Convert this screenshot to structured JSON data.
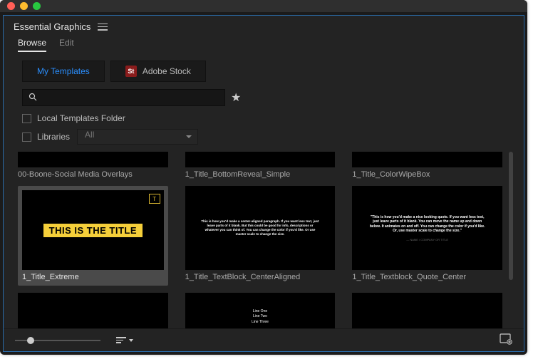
{
  "panel": {
    "title": "Essential Graphics"
  },
  "tabs": {
    "browse": "Browse",
    "edit": "Edit"
  },
  "filters": {
    "my_templates": "My Templates",
    "adobe_stock": "Adobe Stock",
    "st_badge": "St"
  },
  "search": {
    "placeholder": ""
  },
  "checks": {
    "local_templates": "Local Templates Folder",
    "libraries": "Libraries",
    "libraries_select": "All"
  },
  "items": [
    {
      "label": "00-Boone-Social Media Overlays"
    },
    {
      "label": "1_Title_BottomReveal_Simple"
    },
    {
      "label": "1_Title_ColorWipeBox"
    },
    {
      "label": "1_Title_Extreme",
      "preview_title": "THIS IS THE TITLE"
    },
    {
      "label": "1_Title_TextBlock_CenterAligned",
      "preview_body": "This is how you'd make a center-aligned paragraph. If you want less text, just leave parts of it blank. But this could be good for info, descriptions or whatever you can think of. You can change the color if you'd like. Or use master scale to change the size."
    },
    {
      "label": "1_Title_Textblock_Quote_Center",
      "preview_body": "\"This is how you'd make a nice looking quote. If you want less text, just leave parts of it blank. You can move the name up and down below. It animates on and off. You can change the color if you'd like. Or, use master scale to change the size.\"",
      "preview_sub": "— NAME / COMPANY OR TITLE"
    },
    {
      "label": "",
      "preview_lines": "Line One\nLine Two\nLine Three"
    }
  ]
}
